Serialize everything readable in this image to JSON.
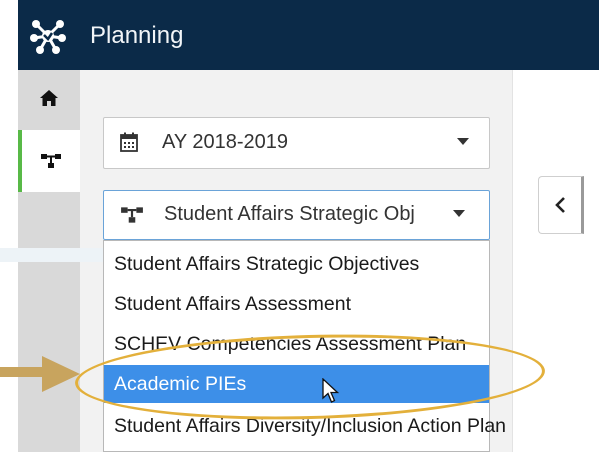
{
  "app": {
    "title": "Planning"
  },
  "rail": {
    "items": [
      "home-icon",
      "hierarchy-icon"
    ]
  },
  "filters": {
    "year_select": {
      "icon": "calendar-icon",
      "value": "AY 2018-2019"
    },
    "plan_select": {
      "icon": "hierarchy-icon",
      "value": "Student Affairs Strategic Obj"
    }
  },
  "dropdown": {
    "options": [
      "Student Affairs Strategic Objectives",
      "Student Affairs Assessment",
      "SCHEV Competencies Assessment Plan",
      "Academic PIEs",
      "Student Affairs Diversity/Inclusion Action Plan"
    ],
    "selected_index": 3
  },
  "colors": {
    "topbar": "#0b2a48",
    "rail": "#d9d9d9",
    "rail_active_accent": "#58b947",
    "selected_option": "#3d8fe8",
    "callout": "#e3b03b"
  }
}
